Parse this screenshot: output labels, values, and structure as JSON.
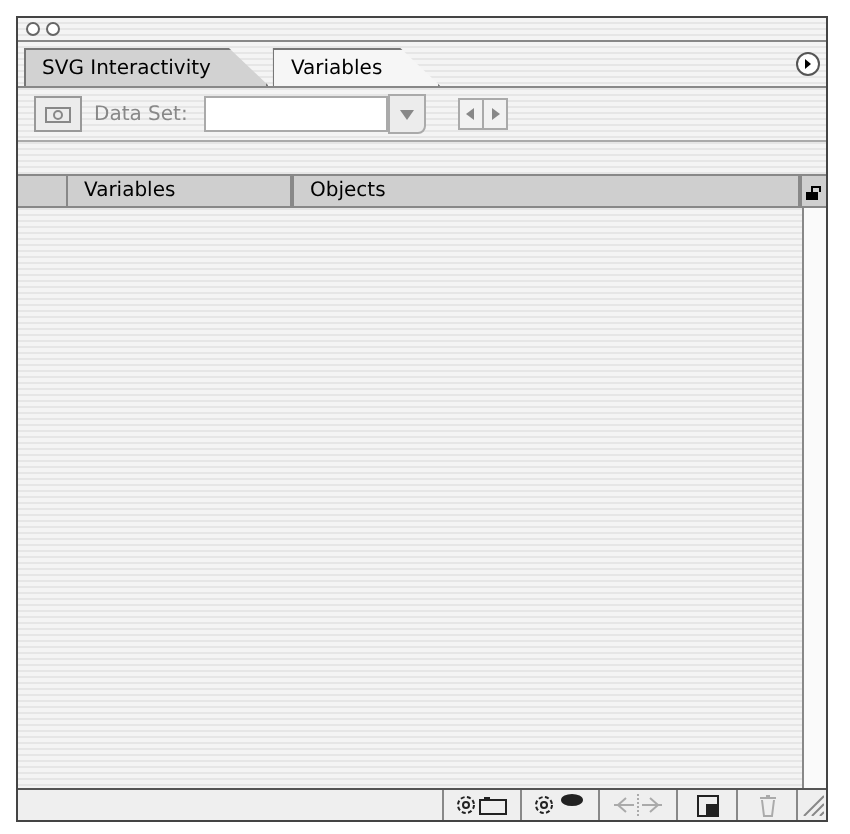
{
  "tabs": [
    {
      "label": "SVG Interactivity",
      "selected": false
    },
    {
      "label": "Variables",
      "selected": true
    }
  ],
  "toolbar": {
    "data_set_label": "Data Set:",
    "disabled": true
  },
  "table": {
    "columns": [
      "Variables",
      "Objects"
    ]
  },
  "bottom_buttons": [
    {
      "kind": "capture",
      "disabled": false
    },
    {
      "kind": "visibility",
      "disabled": false
    },
    {
      "kind": "unbind",
      "disabled": true
    },
    {
      "kind": "new",
      "disabled": false
    },
    {
      "kind": "trash",
      "disabled": true
    }
  ]
}
